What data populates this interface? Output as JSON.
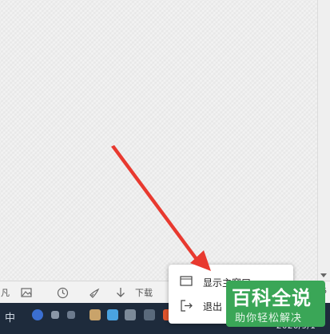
{
  "toolbar": {
    "left_partial_label": "凡",
    "download_label": "下载",
    "right_number": "6"
  },
  "taskbar": {
    "input_method": "中",
    "date": "2020/9/1"
  },
  "context_menu": {
    "items": [
      {
        "label": "显示主窗口",
        "icon": "window-icon"
      },
      {
        "label": "退出",
        "icon": "exit-icon"
      }
    ]
  },
  "watermark": {
    "title": "百科全说",
    "subtitle": "助你轻松解决"
  },
  "colors": {
    "annotation_arrow": "#e8392f",
    "watermark_bg": "#3aa657",
    "taskbar_bg": "#1e2b3c"
  }
}
